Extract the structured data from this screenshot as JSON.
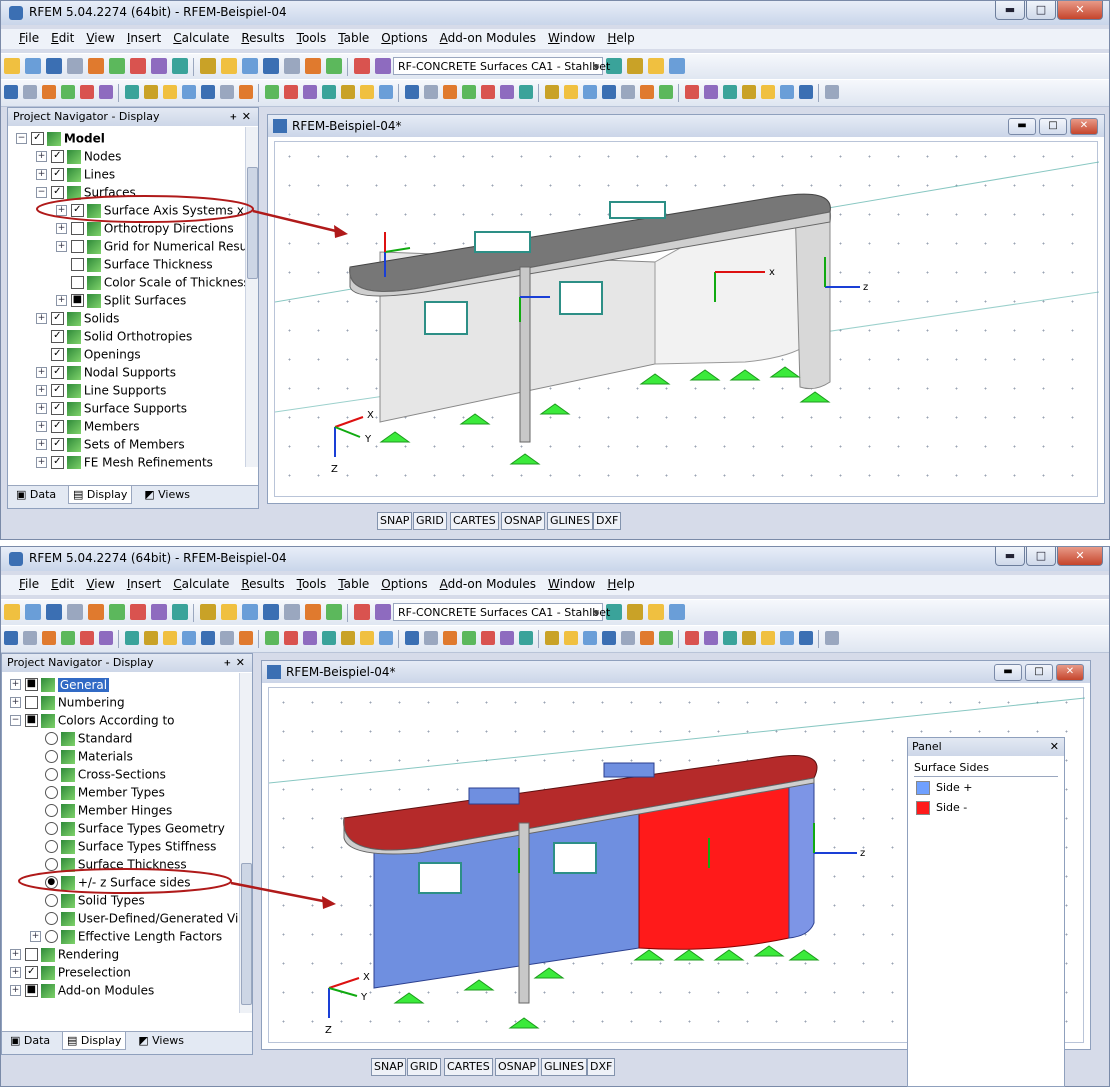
{
  "colors": {
    "accent": "#316ac5",
    "side_plus": "#6fa0ff",
    "side_minus": "#ff1a1a",
    "annotation": "#b01a1a",
    "support": "#3bea3b"
  },
  "app": {
    "title": "RFEM 5.04.2274 (64bit) - RFEM-Beispiel-04"
  },
  "window_buttons": {
    "minimize": "▬",
    "maximize": "□",
    "close": "✕"
  },
  "menu": [
    "File",
    "Edit",
    "View",
    "Insert",
    "Calculate",
    "Results",
    "Tools",
    "Table",
    "Options",
    "Add-on Modules",
    "Window",
    "Help"
  ],
  "toolbar": {
    "combo_value": "RF-CONCRETE Surfaces CA1 - Stahlbet",
    "icons": [
      "new-icon",
      "open-icon",
      "save-icon",
      "print-icon",
      "undo-icon",
      "redo-icon",
      "select-icon",
      "zoom-icon",
      "view-icon",
      "render-icon"
    ]
  },
  "navigator": {
    "title": "Project Navigator - Display",
    "pin": "ᚐ",
    "close": "✕"
  },
  "nav_tabs": {
    "data": "Data",
    "display": "Display",
    "views": "Views"
  },
  "model_title": "RFEM-Beispiel-04*",
  "status_buttons": [
    "SNAP",
    "GRID",
    "CARTES",
    "OSNAP",
    "GLINES",
    "DXF"
  ],
  "top_tree": [
    {
      "indent": 0,
      "exp": "−",
      "chk": "✓",
      "label": "Model",
      "bold": true
    },
    {
      "indent": 1,
      "exp": "+",
      "chk": "✓",
      "label": "Nodes"
    },
    {
      "indent": 1,
      "exp": "+",
      "chk": "✓",
      "label": "Lines"
    },
    {
      "indent": 1,
      "exp": "−",
      "chk": "✓",
      "label": "Surfaces"
    },
    {
      "indent": 2,
      "exp": "+",
      "chk": "✓",
      "label": "Surface Axis Systems x,y,z"
    },
    {
      "indent": 2,
      "exp": "+",
      "chk": "",
      "label": "Orthotropy Directions"
    },
    {
      "indent": 2,
      "exp": "+",
      "chk": "",
      "label": "Grid for Numerical Results"
    },
    {
      "indent": 2,
      "exp": "",
      "chk": "",
      "label": "Surface Thickness"
    },
    {
      "indent": 2,
      "exp": "",
      "chk": "",
      "label": "Color Scale of Thickness"
    },
    {
      "indent": 2,
      "exp": "+",
      "chk": "■",
      "label": "Split Surfaces"
    },
    {
      "indent": 1,
      "exp": "+",
      "chk": "✓",
      "label": "Solids"
    },
    {
      "indent": 1,
      "exp": "",
      "chk": "✓",
      "label": "Solid Orthotropies"
    },
    {
      "indent": 1,
      "exp": "",
      "chk": "✓",
      "label": "Openings"
    },
    {
      "indent": 1,
      "exp": "+",
      "chk": "✓",
      "label": "Nodal Supports"
    },
    {
      "indent": 1,
      "exp": "+",
      "chk": "✓",
      "label": "Line Supports"
    },
    {
      "indent": 1,
      "exp": "+",
      "chk": "✓",
      "label": "Surface Supports"
    },
    {
      "indent": 1,
      "exp": "+",
      "chk": "✓",
      "label": "Members"
    },
    {
      "indent": 1,
      "exp": "+",
      "chk": "✓",
      "label": "Sets of Members"
    },
    {
      "indent": 1,
      "exp": "+",
      "chk": "✓",
      "label": "FE Mesh Refinements"
    }
  ],
  "bottom_tree": [
    {
      "indent": 0,
      "exp": "+",
      "chk": "■",
      "label": "General",
      "sel": true
    },
    {
      "indent": 0,
      "exp": "+",
      "chk": "",
      "label": "Numbering"
    },
    {
      "indent": 0,
      "exp": "−",
      "chk": "■",
      "label": "Colors According to"
    },
    {
      "indent": 1,
      "exp": "",
      "rad": "",
      "label": "Standard"
    },
    {
      "indent": 1,
      "exp": "",
      "rad": "",
      "label": "Materials"
    },
    {
      "indent": 1,
      "exp": "",
      "rad": "",
      "label": "Cross-Sections"
    },
    {
      "indent": 1,
      "exp": "",
      "rad": "",
      "label": "Member Types"
    },
    {
      "indent": 1,
      "exp": "",
      "rad": "",
      "label": "Member Hinges"
    },
    {
      "indent": 1,
      "exp": "",
      "rad": "",
      "label": "Surface Types Geometry"
    },
    {
      "indent": 1,
      "exp": "",
      "rad": "",
      "label": "Surface Types Stiffness"
    },
    {
      "indent": 1,
      "exp": "",
      "rad": "",
      "label": "Surface Thickness"
    },
    {
      "indent": 1,
      "exp": "",
      "rad": "●",
      "label": "+/- z Surface sides"
    },
    {
      "indent": 1,
      "exp": "",
      "rad": "",
      "label": "Solid Types"
    },
    {
      "indent": 1,
      "exp": "",
      "rad": "",
      "label": "User-Defined/Generated Visibility"
    },
    {
      "indent": 1,
      "exp": "+",
      "rad": "",
      "label": "Effective Length Factors"
    },
    {
      "indent": 0,
      "exp": "+",
      "chk": "",
      "label": "Rendering"
    },
    {
      "indent": 0,
      "exp": "+",
      "chk": "✓",
      "label": "Preselection"
    },
    {
      "indent": 0,
      "exp": "+",
      "chk": "■",
      "label": "Add-on Modules"
    }
  ],
  "panel": {
    "title": "Panel",
    "close": "✕",
    "subtitle": "Surface Sides",
    "side_plus": "Side +",
    "side_minus": "Side -"
  },
  "axis_labels": {
    "x": "X",
    "y": "Y",
    "z": "Z",
    "lx": "x",
    "ly": "y",
    "lz": "z"
  }
}
